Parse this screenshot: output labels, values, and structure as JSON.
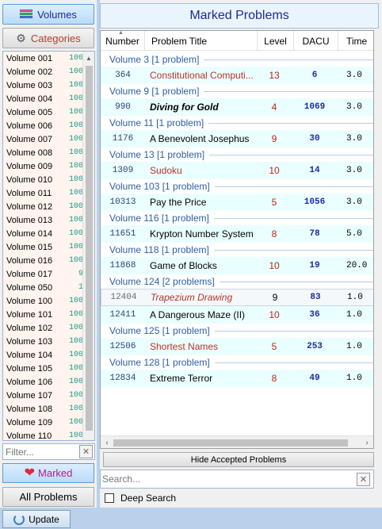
{
  "left": {
    "volumes_label": "Volumes",
    "categories_label": "Categories",
    "volumes": [
      {
        "name": "Volume 001",
        "count": "100"
      },
      {
        "name": "Volume 002",
        "count": "100"
      },
      {
        "name": "Volume 003",
        "count": "100"
      },
      {
        "name": "Volume 004",
        "count": "100"
      },
      {
        "name": "Volume 005",
        "count": "100"
      },
      {
        "name": "Volume 006",
        "count": "100"
      },
      {
        "name": "Volume 007",
        "count": "100"
      },
      {
        "name": "Volume 008",
        "count": "100"
      },
      {
        "name": "Volume 009",
        "count": "100"
      },
      {
        "name": "Volume 010",
        "count": "100"
      },
      {
        "name": "Volume 011",
        "count": "100"
      },
      {
        "name": "Volume 012",
        "count": "100"
      },
      {
        "name": "Volume 013",
        "count": "100"
      },
      {
        "name": "Volume 014",
        "count": "100"
      },
      {
        "name": "Volume 015",
        "count": "100"
      },
      {
        "name": "Volume 016",
        "count": "100"
      },
      {
        "name": "Volume 017",
        "count": "9"
      },
      {
        "name": "Volume 050",
        "count": "1"
      },
      {
        "name": "Volume 100",
        "count": "100"
      },
      {
        "name": "Volume 101",
        "count": "100"
      },
      {
        "name": "Volume 102",
        "count": "100"
      },
      {
        "name": "Volume 103",
        "count": "100"
      },
      {
        "name": "Volume 104",
        "count": "100"
      },
      {
        "name": "Volume 105",
        "count": "100"
      },
      {
        "name": "Volume 106",
        "count": "100"
      },
      {
        "name": "Volume 107",
        "count": "100"
      },
      {
        "name": "Volume 108",
        "count": "100"
      },
      {
        "name": "Volume 109",
        "count": "100"
      },
      {
        "name": "Volume 110",
        "count": "100"
      }
    ],
    "filter_placeholder": "Filter...",
    "marked_label": "Marked",
    "all_problems_label": "All Problems"
  },
  "main": {
    "title": "Marked Problems",
    "columns": [
      "Number",
      "Problem Title",
      "Level",
      "DACU",
      "Time"
    ],
    "groups": [
      {
        "label": "Volume 3 [1 problem]",
        "rows": [
          {
            "number": "364",
            "title": "Constitutional Computi...",
            "level": "13",
            "dacu": "6",
            "time": "3.0",
            "title_style": "red",
            "level_style": "red"
          }
        ]
      },
      {
        "label": "Volume 9 [1 problem]",
        "rows": [
          {
            "number": "990",
            "title": "Diving for Gold",
            "level": "4",
            "dacu": "1069",
            "time": "3.0",
            "title_style": "bold-italic",
            "level_style": "red"
          }
        ]
      },
      {
        "label": "Volume 11 [1 problem]",
        "rows": [
          {
            "number": "1176",
            "title": "A Benevolent Josephus",
            "level": "9",
            "dacu": "30",
            "time": "3.0",
            "title_style": "black",
            "level_style": "red"
          }
        ]
      },
      {
        "label": "Volume 13 [1 problem]",
        "rows": [
          {
            "number": "1309",
            "title": "Sudoku",
            "level": "10",
            "dacu": "14",
            "time": "3.0",
            "title_style": "red",
            "level_style": "red"
          }
        ]
      },
      {
        "label": "Volume 103 [1 problem]",
        "rows": [
          {
            "number": "10313",
            "title": "Pay the Price",
            "level": "5",
            "dacu": "1056",
            "time": "3.0",
            "title_style": "black",
            "level_style": "red"
          }
        ]
      },
      {
        "label": "Volume 116 [1 problem]",
        "rows": [
          {
            "number": "11651",
            "title": "Krypton Number System",
            "level": "8",
            "dacu": "78",
            "time": "5.0",
            "title_style": "black",
            "level_style": "red"
          }
        ]
      },
      {
        "label": "Volume 118 [1 problem]",
        "rows": [
          {
            "number": "11868",
            "title": "Game of Blocks",
            "level": "10",
            "dacu": "19",
            "time": "20.0",
            "title_style": "black",
            "level_style": "red"
          }
        ]
      },
      {
        "label": "Volume 124 [2 problems]",
        "rows": [
          {
            "number": "12404",
            "title": "Trapezium Drawing",
            "level": "9",
            "dacu": "83",
            "time": "1.0",
            "title_style": "red-italic",
            "level_style": "black"
          },
          {
            "number": "12411",
            "title": "A Dangerous Maze (II)",
            "level": "10",
            "dacu": "36",
            "time": "1.0",
            "title_style": "black",
            "level_style": "red"
          }
        ]
      },
      {
        "label": "Volume 125 [1 problem]",
        "rows": [
          {
            "number": "12506",
            "title": "Shortest Names",
            "level": "5",
            "dacu": "253",
            "time": "1.0",
            "title_style": "red",
            "level_style": "red"
          }
        ]
      },
      {
        "label": "Volume 128 [1 problem]",
        "rows": [
          {
            "number": "12834",
            "title": "Extreme Terror",
            "level": "8",
            "dacu": "49",
            "time": "1.0",
            "title_style": "black",
            "level_style": "red"
          }
        ]
      }
    ],
    "hide_accepted_label": "Hide Accepted Problems",
    "search_placeholder": "Search...",
    "deep_search_label": "Deep Search"
  },
  "status": {
    "update_label": "Update"
  },
  "colors": {
    "accent_blue": "#1c2b9c",
    "red_text": "#b8342c",
    "row_bg": "#eaffff",
    "group_text": "#2a5fa8"
  }
}
